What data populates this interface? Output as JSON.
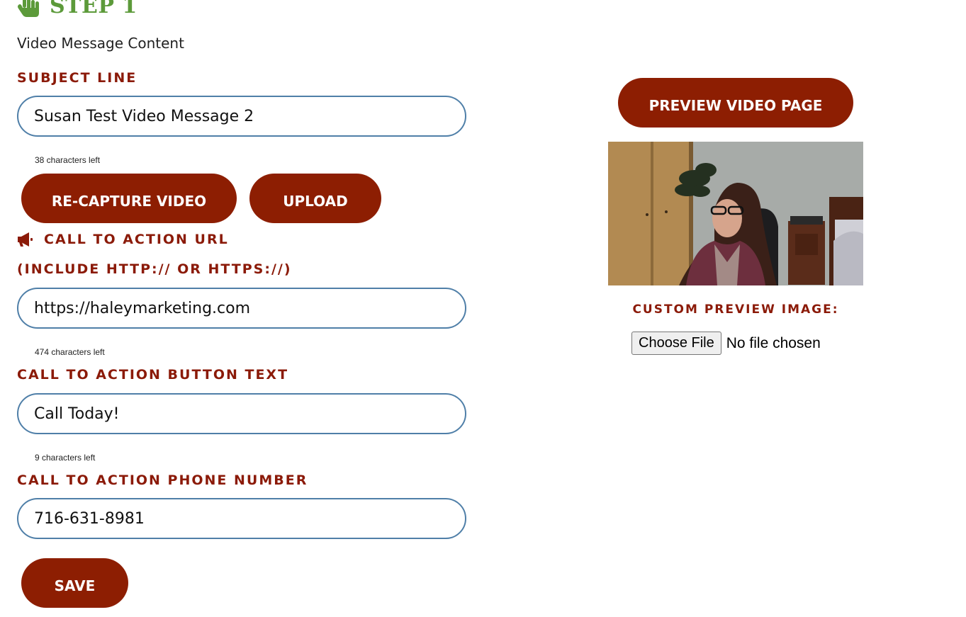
{
  "header": {
    "step_title": "STEP 1",
    "subtitle": "Video Message Content"
  },
  "subject": {
    "label": "SUBJECT LINE",
    "value": "Susan Test Video Message 2",
    "counter": "38 characters left"
  },
  "video_actions": {
    "recapture_label": "RE-CAPTURE VIDEO",
    "upload_label": "UPLOAD"
  },
  "cta_url": {
    "label": "CALL TO ACTION URL",
    "hint": "(INCLUDE HTTP:// OR HTTPS://)",
    "value": "https://haleymarketing.com",
    "counter": "474 characters left"
  },
  "cta_button_text": {
    "label": "CALL TO ACTION BUTTON TEXT",
    "value": "Call Today!",
    "counter": "9 characters left"
  },
  "cta_phone": {
    "label": "CALL TO ACTION PHONE NUMBER",
    "value": "716-631-8981"
  },
  "save_label": "SAVE",
  "preview": {
    "button_label": "PREVIEW VIDEO PAGE",
    "custom_image_label": "CUSTOM PREVIEW IMAGE:",
    "choose_file_label": "Choose File",
    "file_status": "No file chosen"
  },
  "colors": {
    "accent": "#8d1e02",
    "label_text": "#8b1a08",
    "step_green": "#5c9a3a",
    "input_border": "#4f7fa8"
  },
  "icons": {
    "step": "hand-pointer-icon",
    "cta_url": "megaphone-icon"
  }
}
